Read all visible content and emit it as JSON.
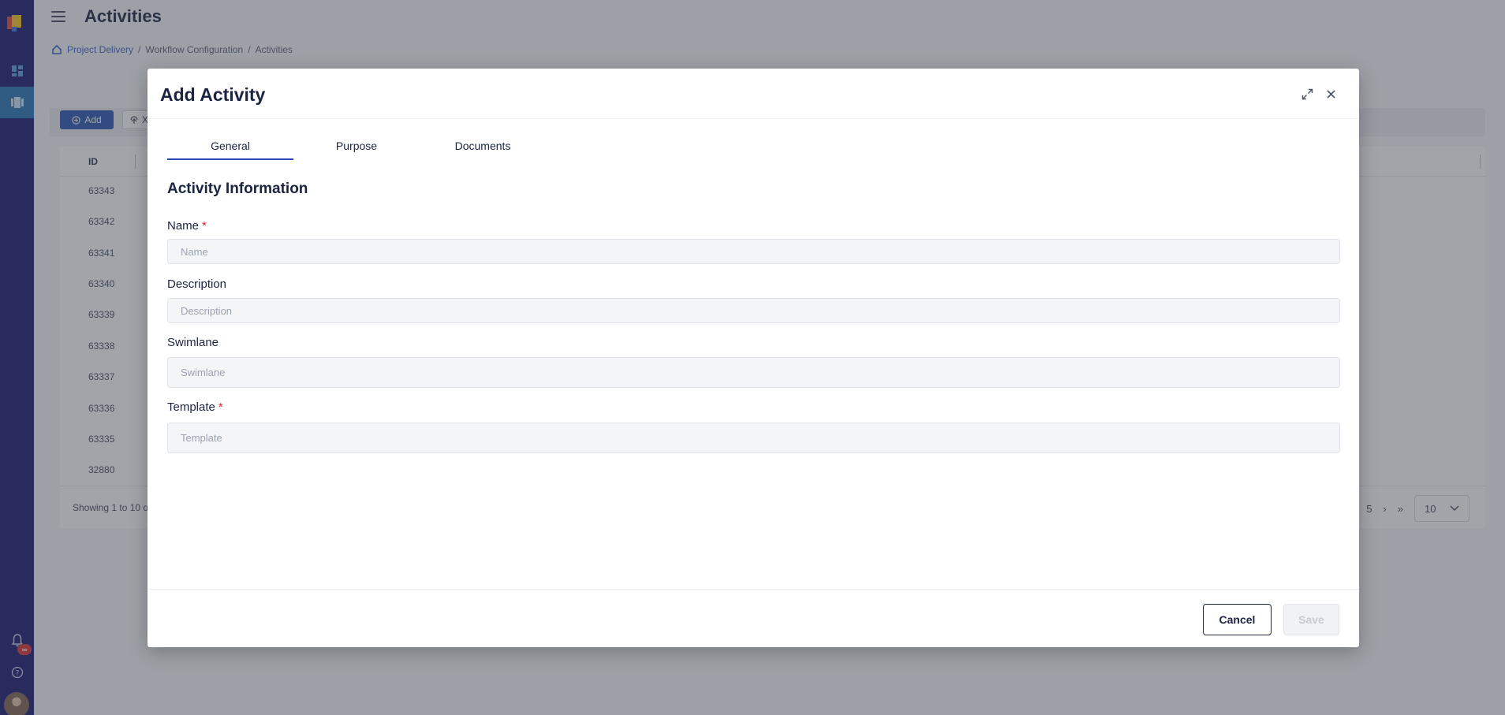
{
  "page": {
    "title": "Activities",
    "breadcrumb": [
      "Project Delivery",
      "Workflow Configuration",
      "Activities"
    ],
    "toolbar": {
      "add_label": "Add",
      "import_label": "X"
    },
    "table": {
      "id_header": "ID",
      "rows": [
        "63343",
        "63342",
        "63341",
        "63340",
        "63339",
        "63338",
        "63337",
        "63336",
        "63335",
        "32880"
      ]
    },
    "footer": {
      "showing": "Showing 1 to 10 o",
      "page_size": "10",
      "pager_prev_partial": "5"
    }
  },
  "sidebar": {
    "notification_badge": "∞",
    "icons": [
      "dashboard-icon",
      "board-icon",
      "bell-icon",
      "help-icon",
      "avatar"
    ]
  },
  "modal": {
    "title": "Add Activity",
    "tabs": [
      {
        "label": "General",
        "active": true
      },
      {
        "label": "Purpose",
        "active": false
      },
      {
        "label": "Documents",
        "active": false
      }
    ],
    "section_title": "Activity Information",
    "fields": {
      "name": {
        "label": "Name",
        "placeholder": "Name",
        "required_mark": "*",
        "value": ""
      },
      "description": {
        "label": "Description",
        "placeholder": "Description",
        "value": ""
      },
      "swimlane": {
        "label": "Swimlane",
        "placeholder": "Swimlane",
        "value": ""
      },
      "template": {
        "label": "Template",
        "placeholder": "Template",
        "required_mark": "*",
        "value": ""
      }
    },
    "cancel_label": "Cancel",
    "save_label": "Save"
  },
  "colors": {
    "sidebar": "#0d0d6b",
    "accent": "#2d45b8",
    "primary_button": "#1f4fb0",
    "required": "#d6262d"
  }
}
